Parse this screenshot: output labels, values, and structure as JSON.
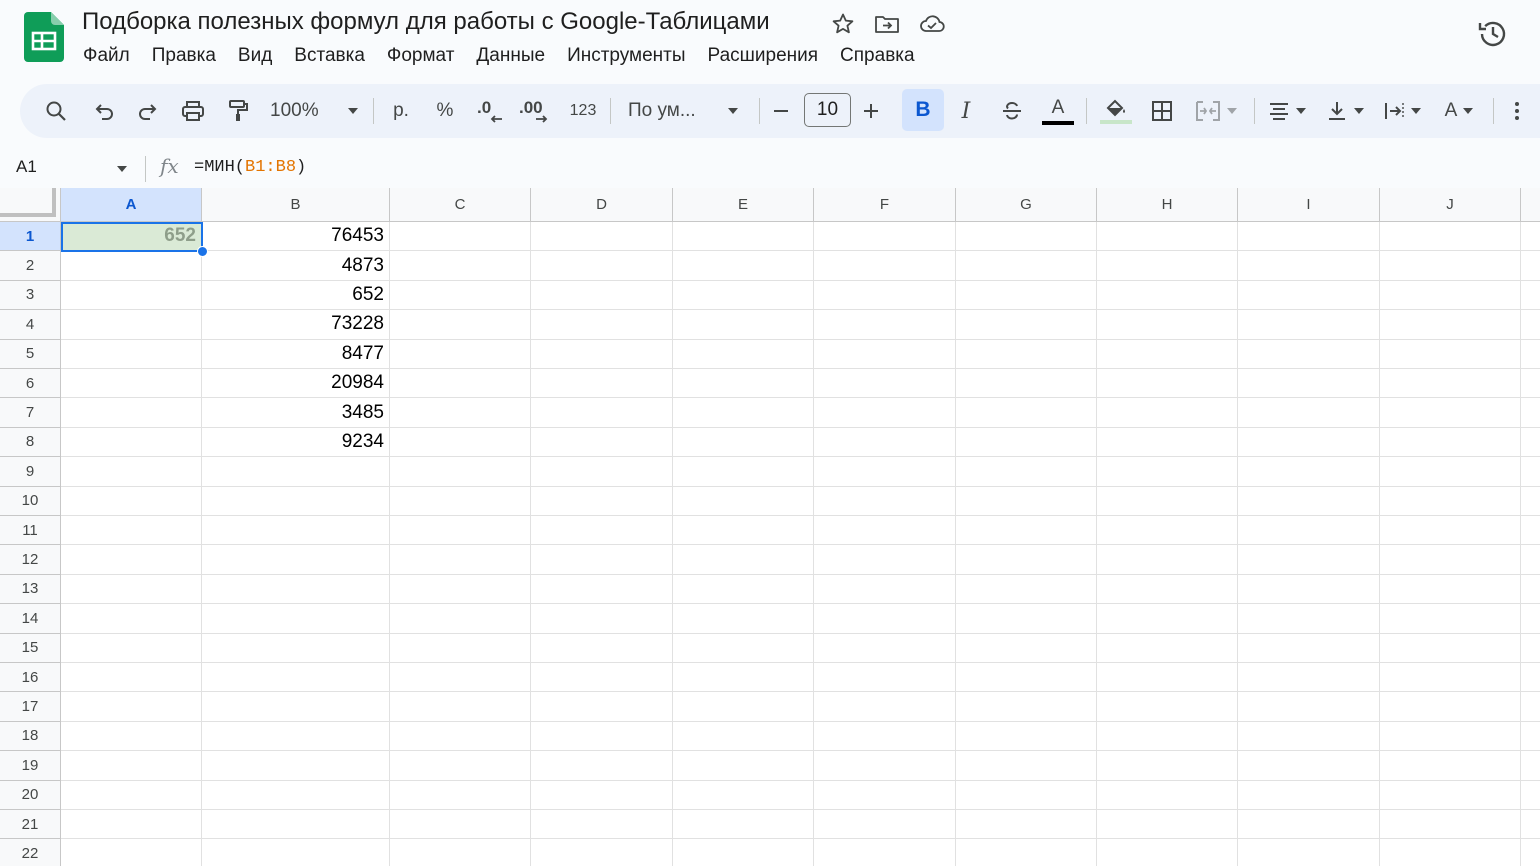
{
  "title": {
    "doc_title": "Подборка полезных формул для работы с Google-Таблицами",
    "icons": [
      "star-icon",
      "move-to-folder-icon",
      "cloud-saved-icon",
      "version-history-icon"
    ]
  },
  "menu": [
    "Файл",
    "Правка",
    "Вид",
    "Вставка",
    "Формат",
    "Данные",
    "Инструменты",
    "Расширения",
    "Справка"
  ],
  "toolbar": {
    "zoom": "100%",
    "currency": "р.",
    "percent": "%",
    "decrease_decimal": ".0",
    "increase_decimal": ".00",
    "number_format": "123",
    "font": "По ум...",
    "font_size": "10",
    "bold": "B",
    "italic": "I",
    "text_color": "A",
    "rotate": "A",
    "accent_color": "#0b57d0",
    "fill_color": "#c8e6c9"
  },
  "formula_bar": {
    "cell_ref": "A1",
    "formula_prefix": "=МИН(",
    "formula_ref": "B1:B8",
    "formula_suffix": ")"
  },
  "sheet": {
    "columns": [
      "A",
      "B",
      "C",
      "D",
      "E",
      "F",
      "G",
      "H",
      "I",
      "J"
    ],
    "rows": [
      "1",
      "2",
      "3",
      "4",
      "5",
      "6",
      "7",
      "8",
      "9",
      "10",
      "11",
      "12",
      "13",
      "14",
      "15",
      "16",
      "17",
      "18",
      "19",
      "20",
      "21",
      "22"
    ],
    "column_a": [
      "652"
    ],
    "column_b": [
      "76453",
      "4873",
      "652",
      "73228",
      "8477",
      "20984",
      "3485",
      "9234"
    ],
    "selected_cell": "A1"
  }
}
